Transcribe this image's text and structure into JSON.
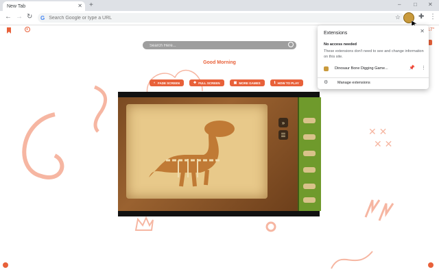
{
  "browser": {
    "tab_title": "New Tab",
    "new_tab": "+",
    "window_min": "–",
    "window_max": "□",
    "window_close": "✕",
    "address_placeholder": "Search Google or type a URL"
  },
  "page": {
    "search_placeholder": "Search Here...",
    "greeting": "Good Morning",
    "buttons": [
      {
        "label": "FADE SCREEN",
        "icon": "fade-icon"
      },
      {
        "label": "FULL SCREEN",
        "icon": "fullscreen-icon"
      },
      {
        "label": "MORE GAMES",
        "icon": "games-icon"
      },
      {
        "label": "HOW TO PLAY",
        "icon": "info-icon"
      }
    ],
    "temperature": "17°",
    "accent_color": "#e8613a"
  },
  "extensions_panel": {
    "title": "Extensions",
    "heading": "No access needed",
    "description": "These extensions don't need to see and change information on this site.",
    "extension_name": "Dinosaur Bone Digging Game...",
    "manage_label": "Manage extensions"
  }
}
